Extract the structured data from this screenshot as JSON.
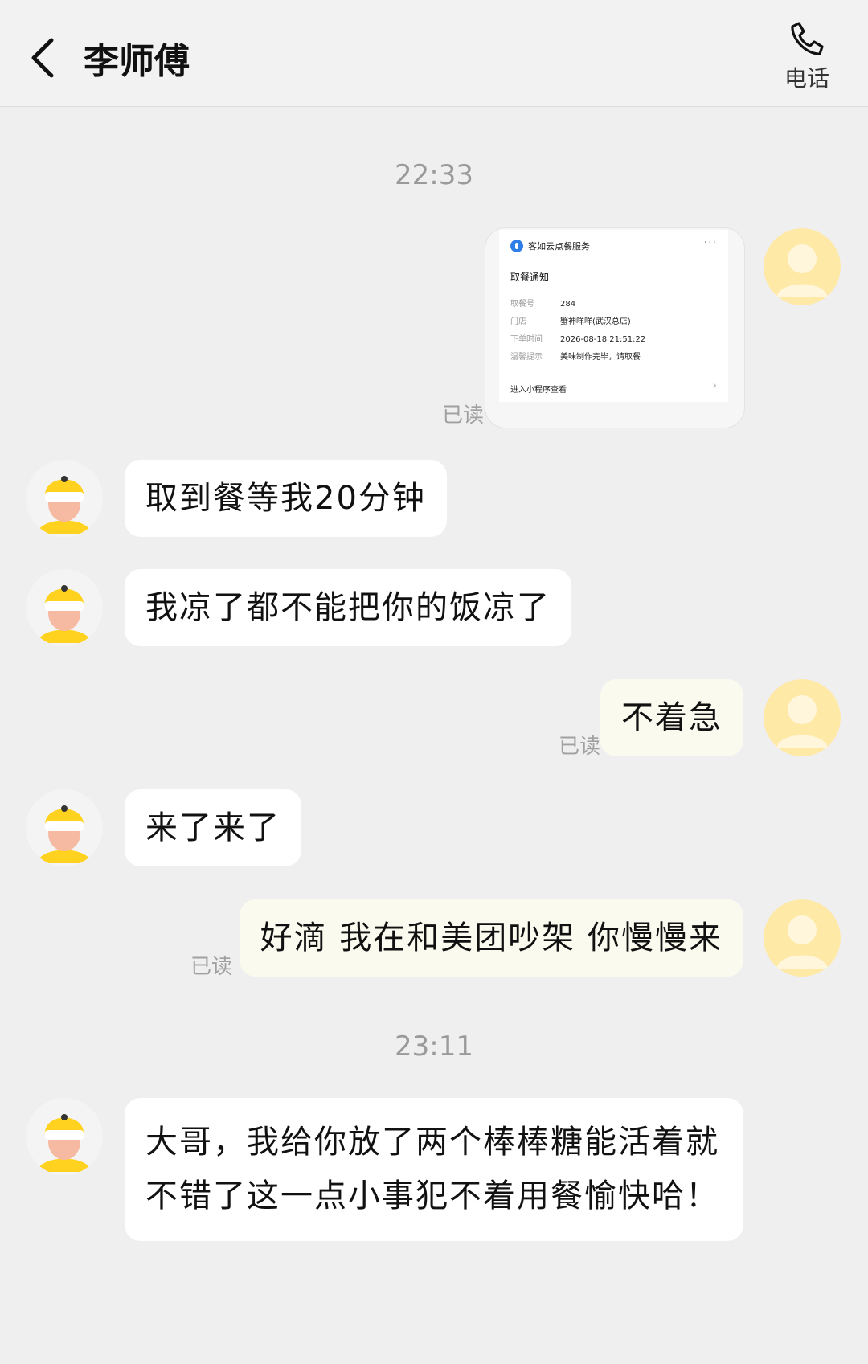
{
  "header": {
    "title": "李师傅",
    "call_label": "电话"
  },
  "times": [
    "22:33",
    "23:11"
  ],
  "read_label": "已读",
  "card": {
    "service": "客如云点餐服务",
    "title": "取餐通知",
    "rows": [
      {
        "k": "取餐号",
        "v": "284"
      },
      {
        "k": "门店",
        "v": "蟹神咩咩(武汉总店)"
      },
      {
        "k": "下单时间",
        "v": "2026-08-18 21:51:22"
      },
      {
        "k": "温馨提示",
        "v": "美味制作完毕，请取餐"
      }
    ],
    "footer": "进入小程序查看"
  },
  "messages": [
    {
      "from": "driver",
      "text": "取到餐等我20分钟"
    },
    {
      "from": "driver",
      "text": "我凉了都不能把你的饭凉了"
    },
    {
      "from": "me",
      "text": "不着急"
    },
    {
      "from": "driver",
      "text": "来了来了"
    },
    {
      "from": "me",
      "text": "好滴 我在和美团吵架 你慢慢来"
    },
    {
      "from": "driver",
      "text": "大哥，我给你放了两个棒棒糖能活着就不错了这一点小事犯不着用餐愉快哈！"
    }
  ],
  "colors": {
    "background": "#efeff0",
    "my_bubble": "#fbfaef",
    "their_bubble": "#ffffff",
    "my_avatar": "#ffe9a6",
    "driver_helmet": "#ffd21f"
  }
}
